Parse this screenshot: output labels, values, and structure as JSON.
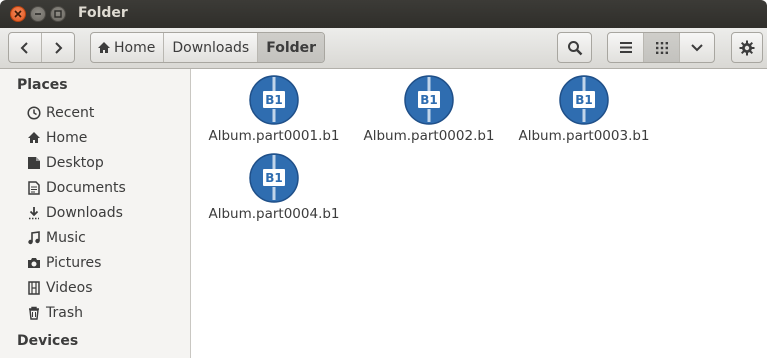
{
  "window": {
    "title": "Folder"
  },
  "breadcrumb": {
    "home": "Home",
    "downloads": "Downloads",
    "current": "Folder"
  },
  "sidebar": {
    "places_heading": "Places",
    "items": [
      {
        "label": "Recent",
        "icon": "clock-icon"
      },
      {
        "label": "Home",
        "icon": "home-icon"
      },
      {
        "label": "Desktop",
        "icon": "desktop-icon"
      },
      {
        "label": "Documents",
        "icon": "documents-icon"
      },
      {
        "label": "Downloads",
        "icon": "downloads-icon"
      },
      {
        "label": "Music",
        "icon": "music-icon"
      },
      {
        "label": "Pictures",
        "icon": "camera-icon"
      },
      {
        "label": "Videos",
        "icon": "film-icon"
      },
      {
        "label": "Trash",
        "icon": "trash-icon"
      }
    ],
    "devices_heading": "Devices"
  },
  "files": [
    {
      "name": "Album.part0001.b1",
      "badge": "B1"
    },
    {
      "name": "Album.part0002.b1",
      "badge": "B1"
    },
    {
      "name": "Album.part0003.b1",
      "badge": "B1"
    },
    {
      "name": "Album.part0004.b1",
      "badge": "B1"
    }
  ],
  "colors": {
    "titlebar": "#3c3b37",
    "close": "#e0541f",
    "file_icon": "#2f6db0"
  }
}
